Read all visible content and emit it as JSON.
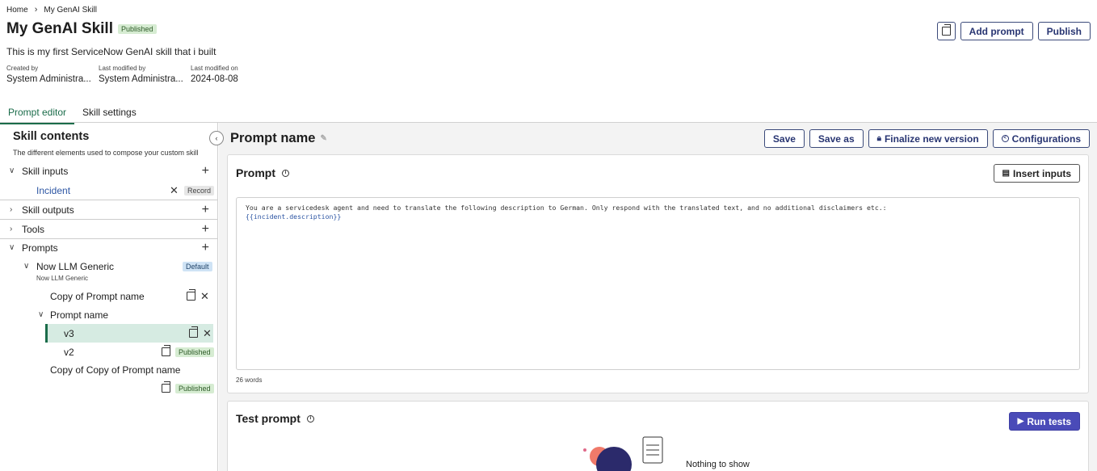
{
  "breadcrumb": {
    "home": "Home",
    "separator": "›",
    "current": "My GenAI Skill"
  },
  "header": {
    "title": "My GenAI Skill",
    "status": "Published",
    "description": "This is my first ServiceNow GenAI skill that i built",
    "meta": [
      {
        "label": "Created by",
        "value": "System Administra..."
      },
      {
        "label": "Last modified by",
        "value": "System Administra..."
      },
      {
        "label": "Last modified on",
        "value": "2024-08-08"
      }
    ],
    "actions": {
      "add_prompt": "Add prompt",
      "publish": "Publish"
    }
  },
  "tabs": [
    {
      "label": "Prompt editor",
      "active": true
    },
    {
      "label": "Skill settings",
      "active": false
    }
  ],
  "sidebar": {
    "title": "Skill contents",
    "subtitle": "The different elements used to compose your custom skill",
    "sections": {
      "inputs": "Skill inputs",
      "input_item": "Incident",
      "input_item_badge": "Record",
      "outputs": "Skill outputs",
      "tools": "Tools",
      "prompts": "Prompts"
    },
    "prompt_tree": {
      "provider": "Now LLM Generic",
      "provider_sub": "Now LLM Generic",
      "provider_badge": "Default",
      "copy_prompt": "Copy of Prompt name",
      "prompt_name": "Prompt name",
      "v3": "v3",
      "v2": "v2",
      "v2_badge": "Published",
      "copy_copy_prompt": "Copy of Copy of Prompt name",
      "copy_copy_badge": "Published"
    }
  },
  "main": {
    "prompt_name": "Prompt name",
    "actions": {
      "save": "Save",
      "save_as": "Save as",
      "finalize": "Finalize new version",
      "configurations": "Configurations"
    },
    "prompt_card": {
      "title": "Prompt",
      "insert_inputs": "Insert inputs",
      "text": "You are a servicedesk agent and need to translate the following description to German. Only respond with the translated text, and no additional disclaimers etc.:",
      "variable": "{{incident.description}}",
      "word_count": "26 words"
    },
    "test_card": {
      "title": "Test prompt",
      "run_tests": "Run tests",
      "empty": "Nothing to show"
    }
  },
  "colors": {
    "accent": "#1b6c4a",
    "primary": "#4a4bb8",
    "button_text": "#283572"
  }
}
